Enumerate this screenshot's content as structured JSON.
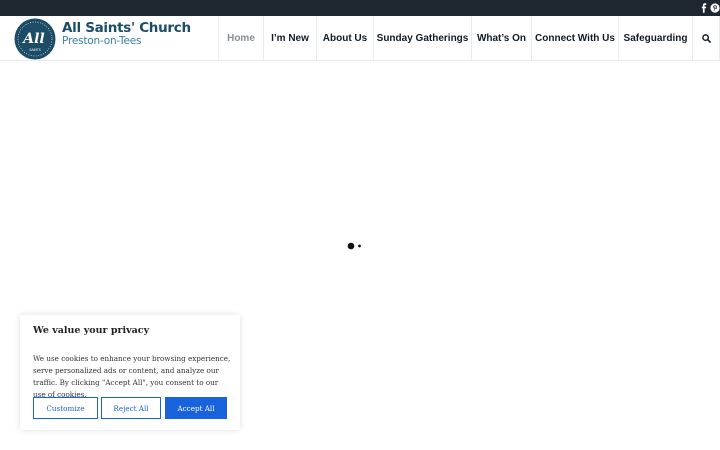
{
  "colors": {
    "topbar": "#1f2730",
    "brand_primary": "#1d4c66",
    "brand_secondary": "#3a7fa3",
    "nav_text": "#111c26",
    "nav_active": "#8a8f95",
    "accent_button": "#1863dc"
  },
  "topbar": {
    "social_icons": [
      "facebook-icon",
      "pinterest-icon"
    ]
  },
  "brand": {
    "logo_text": "All",
    "logo_ring_text": "SAINTS",
    "title": "All Saints' Church",
    "subtitle": "Preston-on-Tees"
  },
  "nav": {
    "items": [
      {
        "label": "Home",
        "active": true
      },
      {
        "label": "I’m New",
        "active": false
      },
      {
        "label": "About Us",
        "active": false
      },
      {
        "label": "Sunday Gatherings",
        "active": false
      },
      {
        "label": "What’s On",
        "active": false
      },
      {
        "label": "Connect With Us",
        "active": false
      },
      {
        "label": "Safeguarding",
        "active": false
      }
    ],
    "search_icon": "search-icon"
  },
  "loader": {
    "icon": "loading-dots-icon"
  },
  "cookie_banner": {
    "title": "We value your privacy",
    "text": "We use cookies to enhance your browsing experience, serve personalized ads or content, and analyze our traffic. By clicking \"Accept All\", you consent to our use of cookies.",
    "customize_label": "Customize",
    "reject_label": "Reject All",
    "accept_label": "Accept All"
  }
}
